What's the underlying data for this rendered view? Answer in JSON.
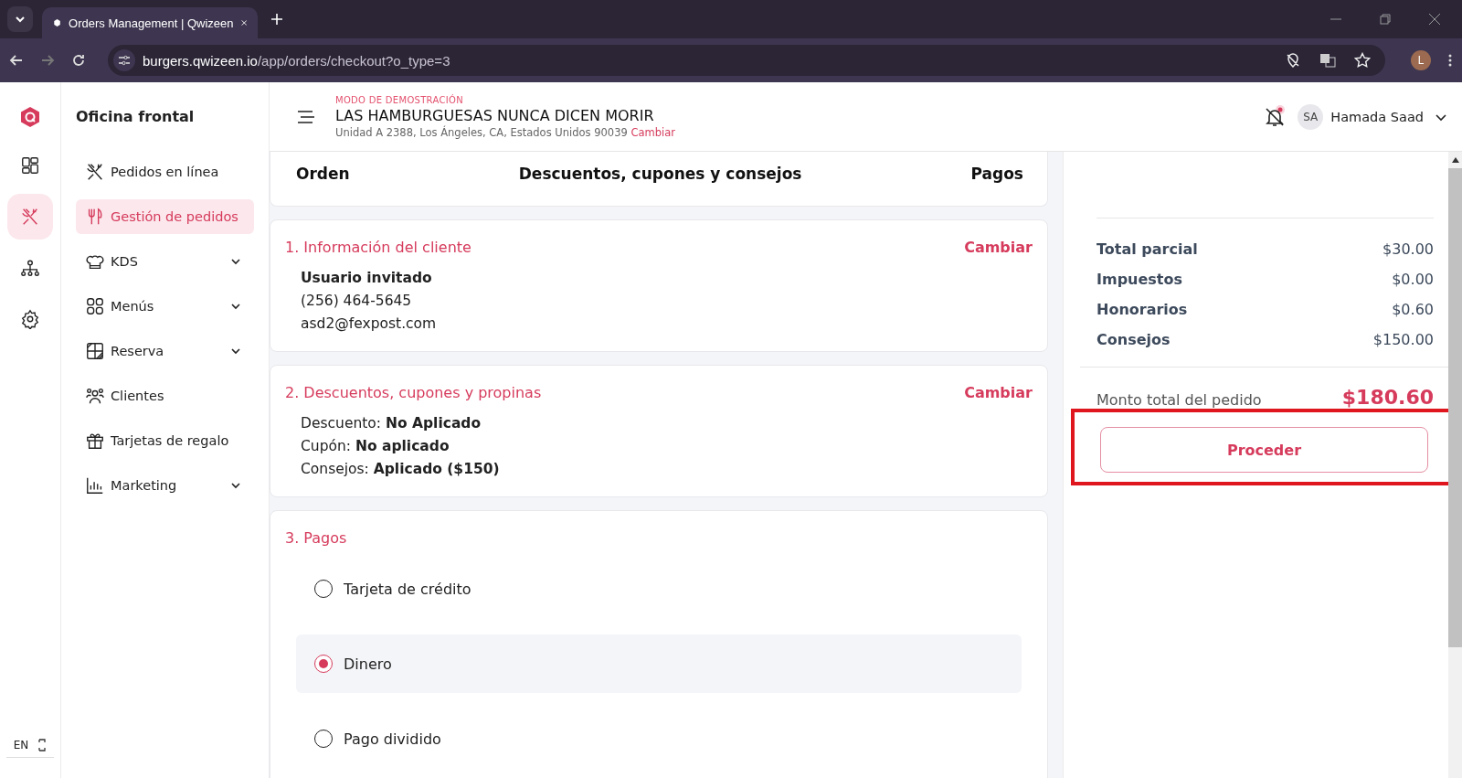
{
  "browser": {
    "tab_title": "Orders Management | Qwizeen",
    "url_host": "burgers.qwizeen.io",
    "url_path": "/app/orders/checkout?o_type=3",
    "profile_initial": "L"
  },
  "rail": {
    "items": [
      {
        "selected": false
      },
      {
        "selected": true
      },
      {
        "selected": false
      },
      {
        "selected": false
      }
    ],
    "language": "EN"
  },
  "sidebar": {
    "title": "Oficina frontal",
    "items": [
      {
        "label": "Pedidos en línea",
        "selected": false,
        "expandable": false
      },
      {
        "label": "Gestión de pedidos",
        "selected": true,
        "expandable": false
      },
      {
        "label": "KDS",
        "selected": false,
        "expandable": true
      },
      {
        "label": "Menús",
        "selected": false,
        "expandable": true
      },
      {
        "label": "Reserva",
        "selected": false,
        "expandable": true
      },
      {
        "label": "Clientes",
        "selected": false,
        "expandable": false
      },
      {
        "label": "Tarjetas de regalo",
        "selected": false,
        "expandable": false
      },
      {
        "label": "Marketing",
        "selected": false,
        "expandable": true
      }
    ]
  },
  "header": {
    "mode": "MODO DE DEMOSTRACIÓN",
    "restaurant": "LAS HAMBURGUESAS NUNCA DICEN MORIR",
    "address": "Unidad A 2388, Los Ángeles, CA, Estados Unidos 90039",
    "address_link": "Cambiar",
    "user_initials": "SA",
    "user_name": "Hamada Saad"
  },
  "steps": [
    "Orden",
    "Descuentos, cupones y consejos",
    "Pagos"
  ],
  "sections": [
    {
      "kind": "text",
      "title": "1. Información del cliente",
      "action": "Cambiar",
      "lines": [
        "**Usuario invitado**",
        "(256) 464-5645",
        "asd2@fexpost.com"
      ]
    },
    {
      "kind": "text",
      "title": "2. Descuentos, cupones y propinas",
      "action": "Cambiar",
      "lines": [
        "Descuento: **No Aplicado**",
        "Cupón: **No aplicado**",
        "Consejos: **Aplicado ($150)**"
      ]
    },
    {
      "kind": "options",
      "title": "3. Pagos",
      "options": [
        {
          "label": "Tarjeta de crédito",
          "selected": false
        },
        {
          "label": "Dinero",
          "selected": true
        },
        {
          "label": "Pago dividido",
          "selected": false
        }
      ]
    }
  ],
  "summary": {
    "rows": [
      {
        "label": "Total parcial",
        "value": "$30.00"
      },
      {
        "label": "Impuestos",
        "value": "$0.00"
      },
      {
        "label": "Honorarios",
        "value": "$0.60"
      },
      {
        "label": "Consejos",
        "value": "$150.00"
      }
    ],
    "total_label": "Monto total del pedido",
    "total_value": "$180.60",
    "button": "Proceder",
    "highlighted": true
  }
}
